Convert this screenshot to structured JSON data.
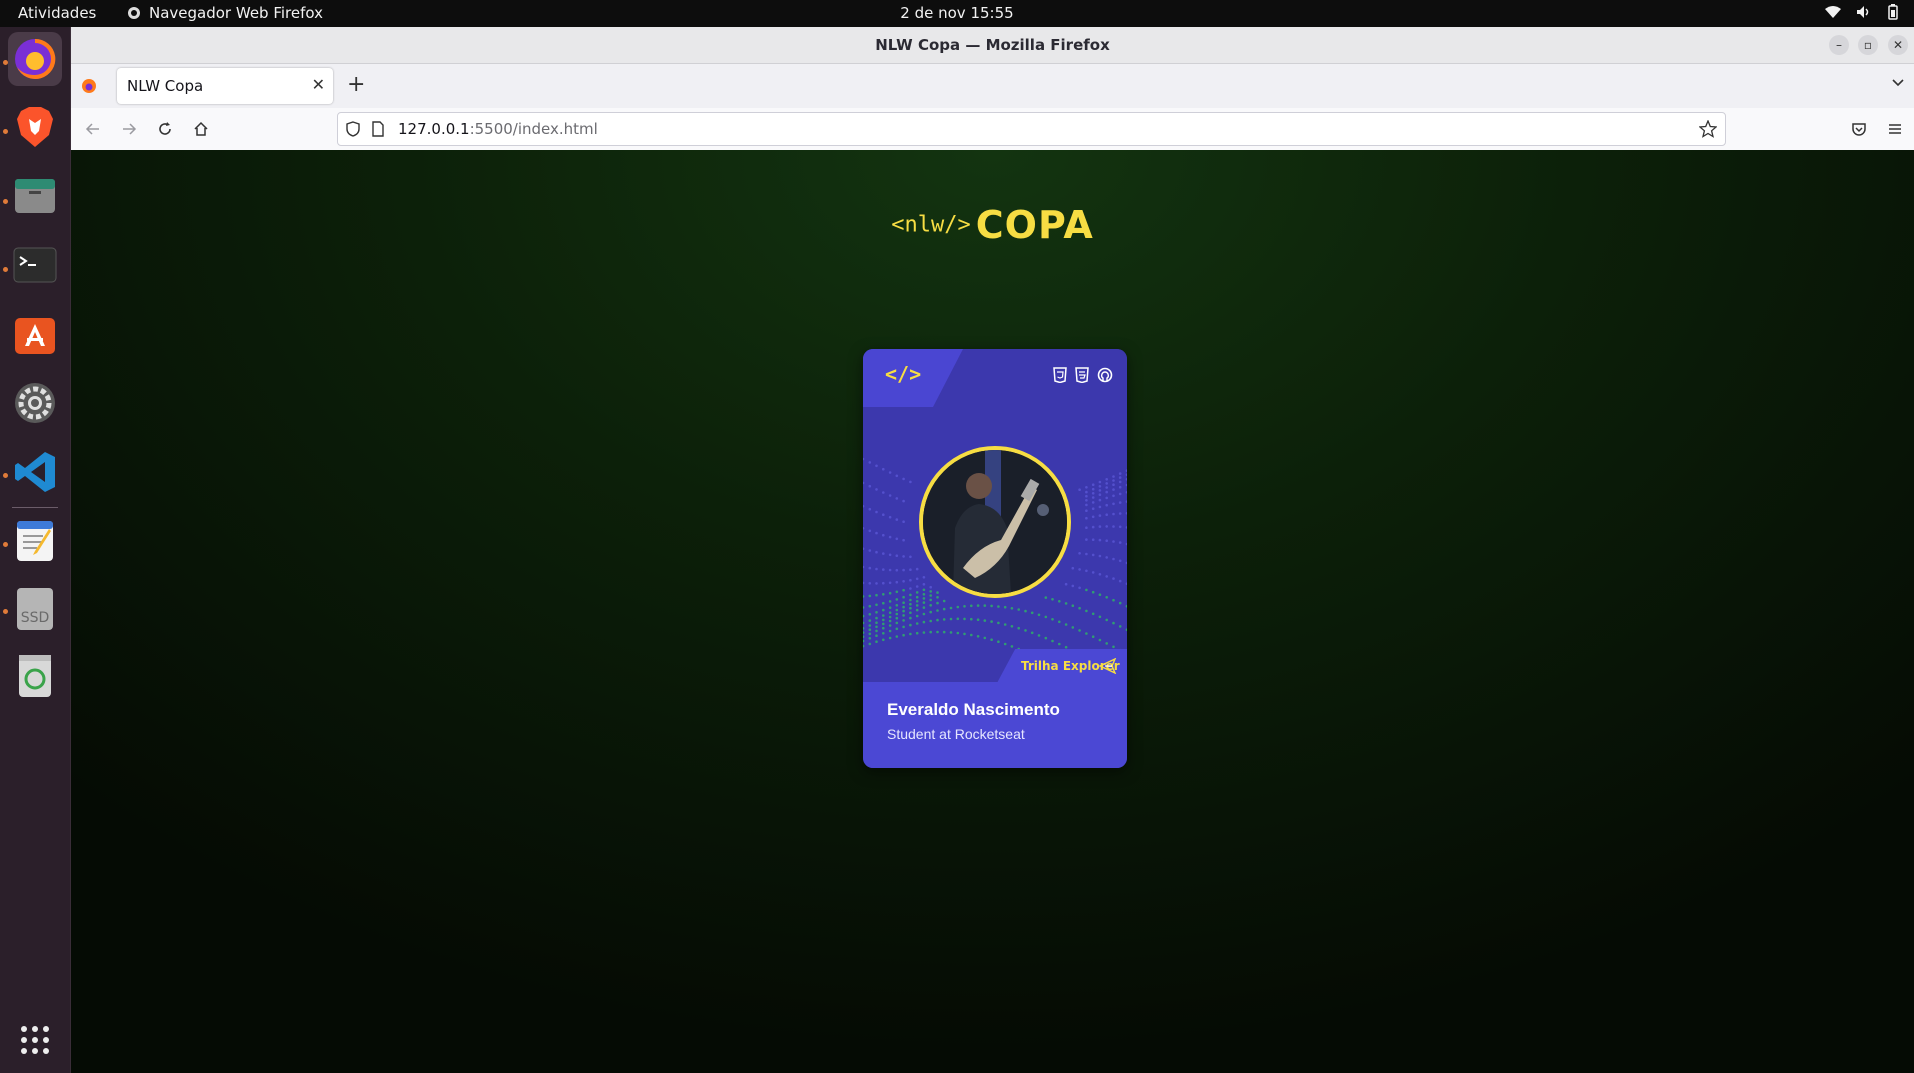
{
  "topbar": {
    "activities": "Atividades",
    "app_name": "Navegador Web Firefox",
    "datetime": "2 de nov  15:55"
  },
  "window": {
    "title": "NLW Copa — Mozilla Firefox"
  },
  "tabs": [
    {
      "label": "NLW Copa"
    }
  ],
  "urlbar": {
    "host": "127.0.0.1",
    "path": ":5500/index.html"
  },
  "page": {
    "logo_tag": "<nlw/>",
    "logo_text": "COPA",
    "card": {
      "code_symbol": "</>",
      "badge_label": "Trilha Explorer",
      "name": "Everaldo Nascimento",
      "role": "Student at Rocketseat"
    }
  },
  "dock": {
    "ssd_label": "SSD"
  },
  "colors": {
    "accent_yellow": "#f7dd43",
    "card_blue": "#3c38ad",
    "card_bottom": "#4b48d4",
    "dock_bg": "#2b1f2a"
  }
}
